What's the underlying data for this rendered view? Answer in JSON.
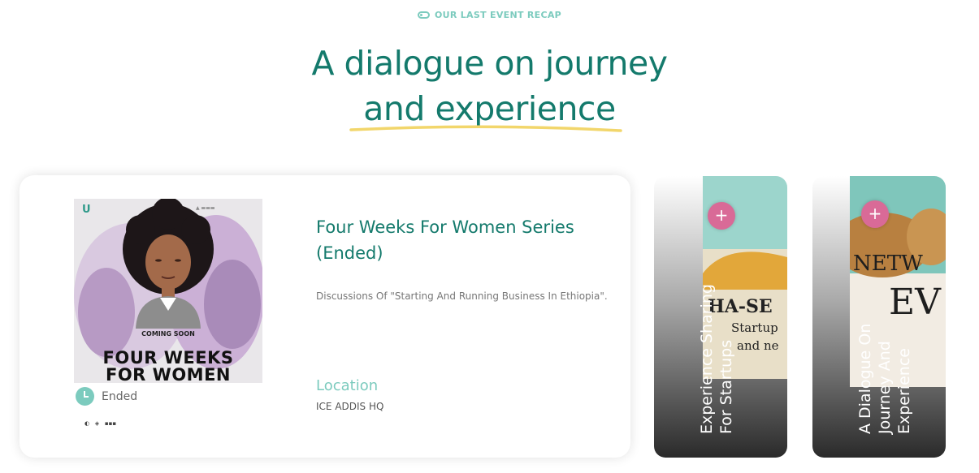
{
  "header": {
    "eyebrow": "OUR LAST EVENT RECAP",
    "headline_line1": "A dialogue on journey",
    "headline_line2": "and experience"
  },
  "featured_event": {
    "poster": {
      "coming_soon": "COMING SOON",
      "title_line1": "FOUR WEEKS",
      "title_line2": "FOR WOMEN"
    },
    "status": "Ended",
    "title": "Four Weeks For Women Series (Ended)",
    "description": "Discussions Of \"Starting And Running Business In Ethiopia\".",
    "location_label": "Location",
    "location_value": "ICE ADDIS HQ"
  },
  "side_events": [
    {
      "label_line1": "Experience Sharing",
      "label_line2": "For Startups",
      "plus_icon": "+",
      "icon": "plus-icon"
    },
    {
      "label_line1": "A Dialogue On",
      "label_line2": "Journey And",
      "label_line3": "Experience",
      "plus_icon": "+",
      "icon": "plus-icon"
    }
  ],
  "colors": {
    "brand_teal": "#147a6c",
    "accent_mint": "#7ccbbe",
    "accent_pink": "#d96a97",
    "underline_yellow": "#f2d66b"
  }
}
